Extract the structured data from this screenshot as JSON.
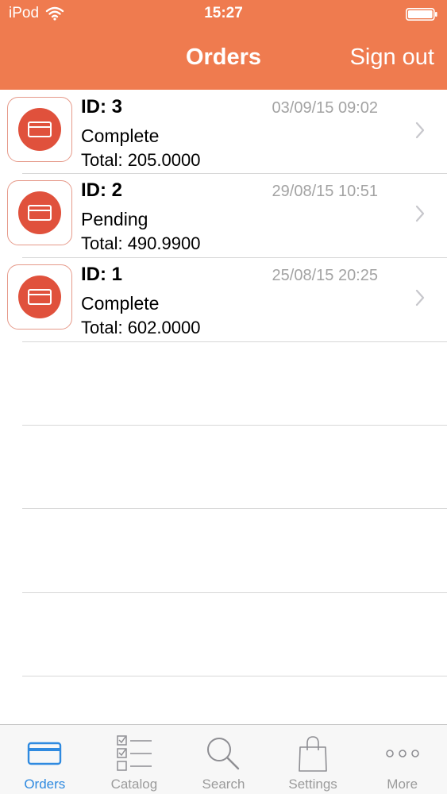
{
  "status_bar": {
    "carrier": "iPod",
    "time": "15:27"
  },
  "nav": {
    "title": "Orders",
    "sign_out_label": "Sign out"
  },
  "colors": {
    "header_bg": "#ef7b4f",
    "accent": "#e0513c",
    "active_tab": "#2f8ae0"
  },
  "orders": [
    {
      "id_label": "ID: 3",
      "date": "03/09/15 09:02",
      "status": "Complete",
      "total": "Total: 205.0000"
    },
    {
      "id_label": "ID: 2",
      "date": "29/08/15 10:51",
      "status": "Pending",
      "total": "Total: 490.9900"
    },
    {
      "id_label": "ID: 1",
      "date": "25/08/15 20:25",
      "status": "Complete",
      "total": "Total: 602.0000"
    }
  ],
  "tabs": [
    {
      "label": "Orders",
      "icon": "card-icon",
      "active": true
    },
    {
      "label": "Catalog",
      "icon": "checklist-icon",
      "active": false
    },
    {
      "label": "Search",
      "icon": "search-icon",
      "active": false
    },
    {
      "label": "Settings",
      "icon": "bag-icon",
      "active": false
    },
    {
      "label": "More",
      "icon": "more-icon",
      "active": false
    }
  ]
}
